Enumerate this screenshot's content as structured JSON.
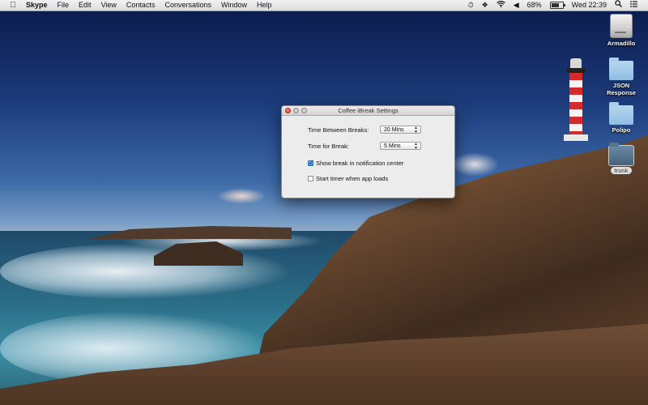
{
  "menubar": {
    "apple": "",
    "app_name": "Skype",
    "menus": [
      "File",
      "Edit",
      "View",
      "Contacts",
      "Conversations",
      "Window",
      "Help"
    ],
    "status": {
      "battery_percent": "68%",
      "battery_level": 0.68,
      "clock": "Wed 22:39",
      "icons": [
        "timer-icon",
        "dropbox-icon",
        "wifi-icon",
        "volume-icon",
        "battery-icon",
        "spotlight-icon",
        "notification-center-icon"
      ]
    }
  },
  "desktop_icons": [
    {
      "label": "Armadillo",
      "kind": "drive"
    },
    {
      "label": "JSON Response",
      "kind": "folder"
    },
    {
      "label": "Polipo",
      "kind": "folder"
    },
    {
      "label": "trunk",
      "kind": "folder-selected"
    }
  ],
  "window": {
    "title": "Coffee iBreak Settings",
    "time_between_label": "Time Between Breaks:",
    "time_between_value": "20 Mins",
    "time_for_break_label": "Time for Break:",
    "time_for_break_value": "5 Mins",
    "show_notification_label": "Show break in notification center",
    "show_notification_checked": true,
    "start_timer_label": "Start timer when app loads",
    "start_timer_checked": false
  }
}
